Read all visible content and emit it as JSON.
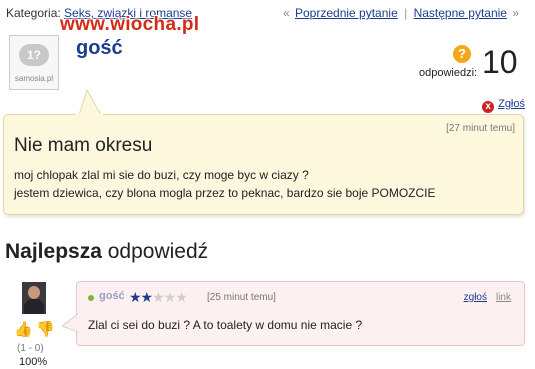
{
  "topbar": {
    "category_label": "Kategoria:",
    "category_link": "Seks, związki i romanse",
    "prev_arrow": "«",
    "prev_label": "Poprzednie pytanie",
    "separator": "|",
    "next_label": "Następne pytanie",
    "next_arrow": "»"
  },
  "watermark": "www.wiocha.pl",
  "avatar": {
    "bubble_text": "1?",
    "brand": "samosia.pl"
  },
  "author": {
    "name": "gość"
  },
  "answers": {
    "icon": "question-badge-icon",
    "label": "odpowiedzi:",
    "count": "10"
  },
  "report_top": {
    "icon": "x",
    "label": "Zgłoś"
  },
  "question": {
    "time": "[27 minut temu]",
    "title": "Nie mam okresu",
    "line1": "moj chlopak zlal mi sie do buzi, czy moge byc w ciazy ?",
    "line2": "jestem dziewica, czy blona mogla przez to peknac, bardzo sie boje POMOZCIE"
  },
  "best": {
    "heading_bold": "Najlepsza",
    "heading_rest": " odpowiedź",
    "username": "gość",
    "stars_on": "★★",
    "stars_off": "★★★",
    "rating": 2,
    "rating_max": 5,
    "time": "[25 minut temu]",
    "report": "zgłoś",
    "link": "link",
    "text": "Zlal ci sei do buzi ? A to toalety w domu nie macie ?",
    "thumb_up": "👍",
    "thumb_down": "👎",
    "votes": "(1 - 0)",
    "percent": "100%"
  },
  "colors": {
    "accent": "#1a3d8f",
    "question_bg": "#fdf8dd",
    "answer_bg": "#fdf0f1",
    "badge": "#f3a81a"
  }
}
